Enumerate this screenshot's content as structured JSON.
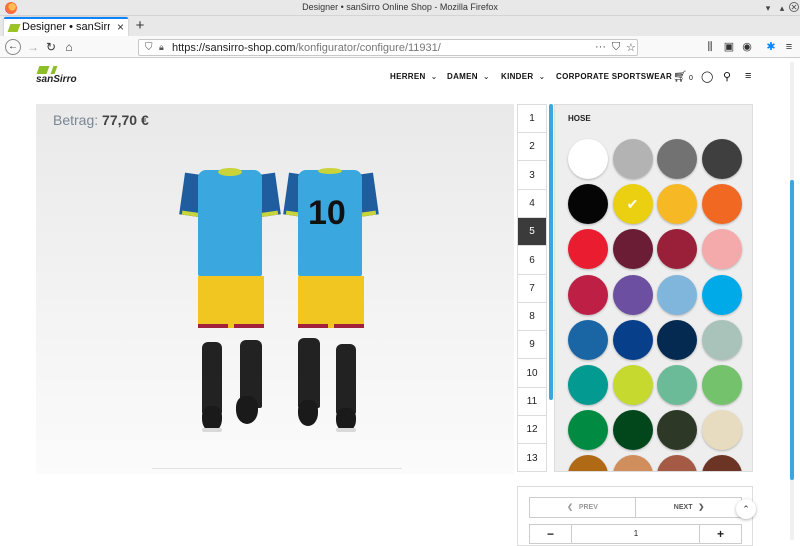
{
  "window": {
    "title": "Designer • sanSirro Online Shop - Mozilla Firefox"
  },
  "browser": {
    "tab_title": "Designer • sanSirro",
    "url_host": "https://sansirro-shop.com",
    "url_path": "/konfigurator/configure/11931/"
  },
  "site": {
    "logo_text": "sanSirro",
    "nav": [
      {
        "label": "HERREN"
      },
      {
        "label": "DAMEN"
      },
      {
        "label": "KINDER"
      },
      {
        "label": "CORPORATE SPORTSWEAR"
      }
    ],
    "cart_count": "0"
  },
  "preview": {
    "price_label": "Betrag:",
    "price_value": "77,70 €",
    "jersey_number": "10"
  },
  "steps": [
    "1",
    "2",
    "3",
    "4",
    "5",
    "6",
    "7",
    "8",
    "9",
    "10",
    "11",
    "12",
    "13"
  ],
  "active_step": "5",
  "panel": {
    "title": "HOSE",
    "selected_index": 5,
    "colors": [
      "#ffffff",
      "#b3b3b3",
      "#727272",
      "#3f3f3f",
      "#050505",
      "#ead010",
      "#f6b824",
      "#f16822",
      "#ea1c30",
      "#6b1d36",
      "#9a1f38",
      "#f4a9aa",
      "#bd1f45",
      "#6c4fa1",
      "#80b6dc",
      "#00a9e8",
      "#1a66a4",
      "#073f8b",
      "#052a52",
      "#a9c3bb",
      "#039a91",
      "#c5d92f",
      "#6bbb99",
      "#74c26c",
      "#018a41",
      "#02471c",
      "#2e3827",
      "#e7dcbf",
      "#b06a16",
      "#d18e5d",
      "#a55a45",
      "#6b3425"
    ]
  },
  "controls": {
    "prev_label": "PREV",
    "next_label": "NEXT",
    "quantity": "1",
    "minus_label": "−",
    "plus_label": "+"
  }
}
